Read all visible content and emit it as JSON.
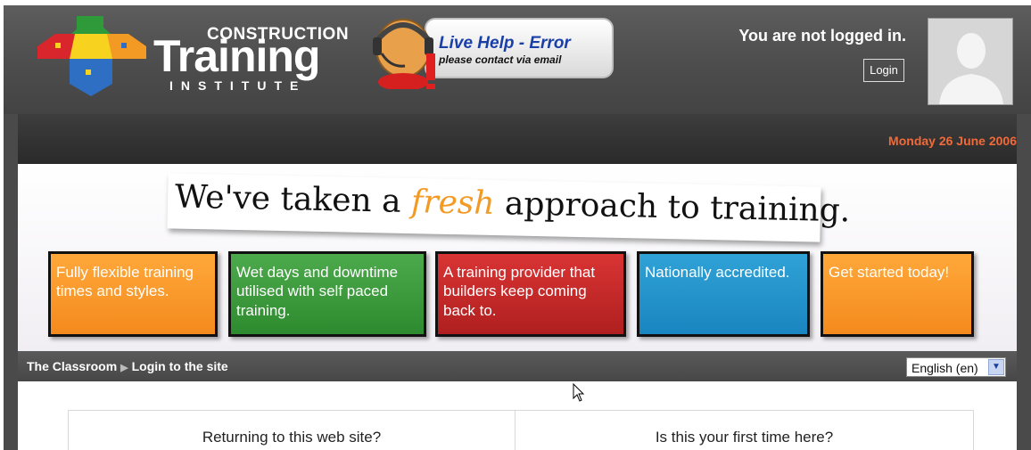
{
  "header": {
    "logo": {
      "line1": "CONSTRUCTION",
      "line2": "Training",
      "line3": "INSTITUTE",
      "colors": {
        "red": "#d8262c",
        "green": "#2e9a3a",
        "blue": "#2f6fc3",
        "orange": "#f39a24",
        "yellow": "#f7d21e"
      }
    },
    "live_help": {
      "title": "Live Help - Error",
      "subtitle": "please contact via email",
      "icon": "headset-operator-icon"
    },
    "login_status": "You are not logged in.",
    "login_button": "Login",
    "avatar_icon": "user-silhouette-icon"
  },
  "date": "Monday 26 June 2006",
  "banner": {
    "tagline_before": "We've taken a ",
    "tagline_emphasis": "fresh",
    "tagline_after": " approach to training.",
    "tiles": [
      {
        "text": "Fully flexible training times and styles.",
        "color": "#f7941d"
      },
      {
        "text": "Wet days and downtime utilised with self paced training.",
        "color": "#3a9a3a"
      },
      {
        "text": "A training provider that builders keep coming back to.",
        "color": "#c62828"
      },
      {
        "text": "Nationally accredited.",
        "color": "#2196d3"
      },
      {
        "text": "Get started today!",
        "color": "#f7941d"
      }
    ]
  },
  "breadcrumb": {
    "items": [
      "The Classroom",
      "Login to the site"
    ],
    "separator": "▶"
  },
  "language": {
    "selected": "English (en)"
  },
  "login_panel": {
    "returning_heading": "Returning to this web site?",
    "first_time_heading": "Is this your first time here?"
  },
  "colors": {
    "accent_date": "#f06a3a",
    "header_bg": "#4e4e4e",
    "date_bar": "#333333"
  }
}
